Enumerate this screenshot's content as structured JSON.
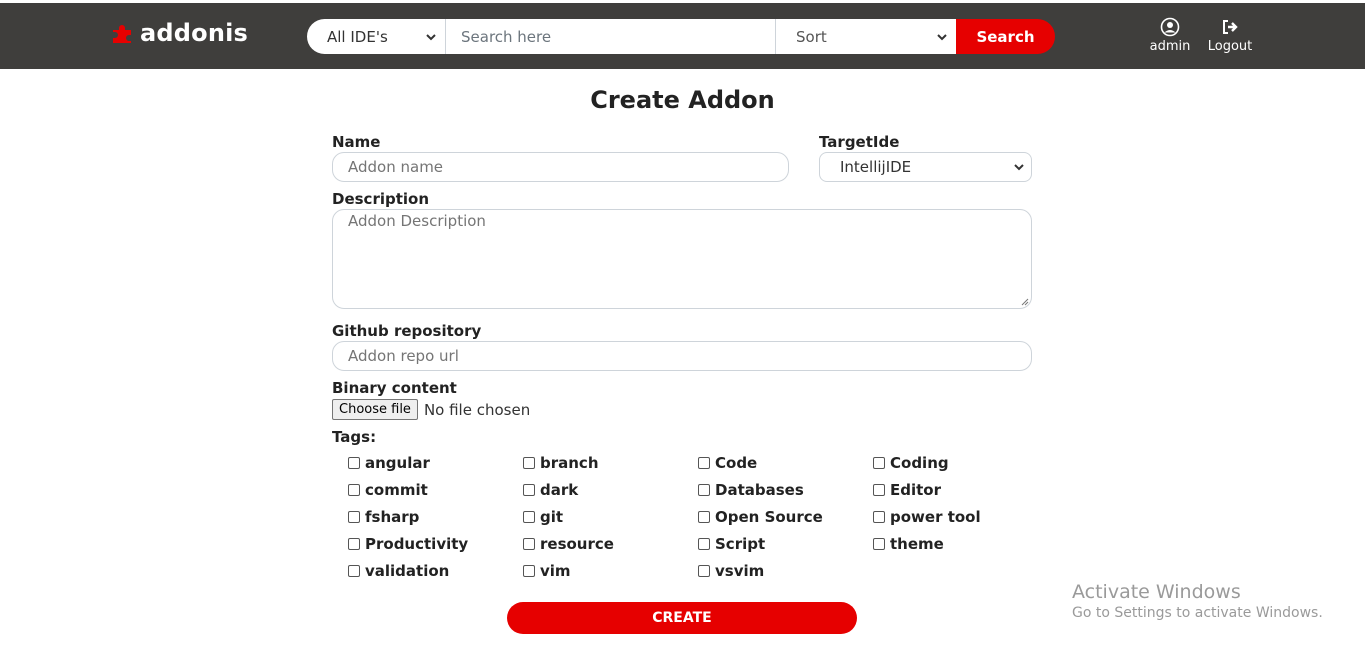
{
  "header": {
    "logo_text": "addonis",
    "ide_filter": {
      "selected": "All IDE's"
    },
    "search": {
      "placeholder": "Search here"
    },
    "sort": {
      "selected": "Sort"
    },
    "search_button": "Search",
    "user_label": "admin",
    "logout_label": "Logout"
  },
  "form": {
    "title": "Create Addon",
    "name": {
      "label": "Name",
      "placeholder": "Addon name"
    },
    "target_ide": {
      "label": "TargetIde",
      "selected": "IntellijIDE"
    },
    "description": {
      "label": "Description",
      "placeholder": "Addon Description"
    },
    "github": {
      "label": "Github repository",
      "placeholder": "Addon repo url"
    },
    "binary": {
      "label": "Binary content",
      "button": "Choose file",
      "status": "No file chosen"
    },
    "tags_label": "Tags:",
    "tags": [
      "angular",
      "branch",
      "Code",
      "Coding",
      "commit",
      "dark",
      "Databases",
      "Editor",
      "fsharp",
      "git",
      "Open Source",
      "power tool",
      "Productivity",
      "resource",
      "Script",
      "theme",
      "validation",
      "vim",
      "vsvim"
    ],
    "create_button": "CREATE"
  },
  "watermark": {
    "title": "Activate Windows",
    "subtitle": "Go to Settings to activate Windows."
  },
  "colors": {
    "header_bg": "#3f3e3c",
    "accent": "#e60000"
  },
  "icons": {
    "logo": "puzzle-piece-icon",
    "user": "user-circle-icon",
    "logout": "sign-out-icon",
    "dropdown": "chevron-down-icon"
  }
}
